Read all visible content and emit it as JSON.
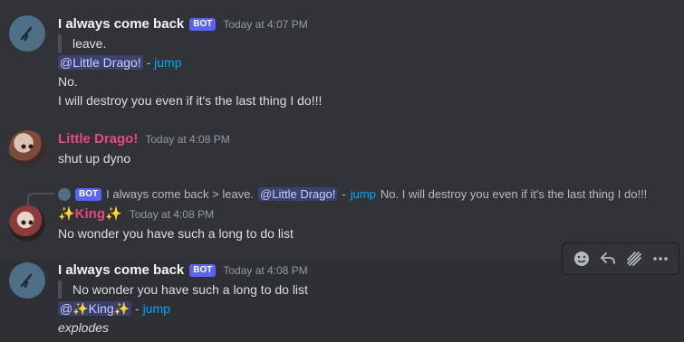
{
  "messages": [
    {
      "author": "I always come back",
      "bot_tag": "BOT",
      "time": "Today at 4:07 PM",
      "quote": "leave.",
      "mention": "@Little Drago!",
      "dash": "-",
      "jump": "jump",
      "line1": "No.",
      "line2": "I will destroy you even if it's the last thing I do!!!"
    },
    {
      "author": "Little Drago!",
      "time": "Today at 4:08 PM",
      "text": "shut up dyno"
    },
    {
      "reply": {
        "bot_tag": "BOT",
        "text_a": "I always come back > leave.",
        "mention": "@Little Drago!",
        "dash": "-",
        "jump": "jump",
        "text_b": "No. I will destroy you even if it's the last thing I do!!!"
      },
      "author": "✨King✨",
      "time": "Today at 4:08 PM",
      "text": "No wonder you have such a long to do list"
    },
    {
      "author": "I always come back",
      "bot_tag": "BOT",
      "time": "Today at 4:08 PM",
      "quote": "No wonder you have such a long to do list",
      "mention": "@✨King✨",
      "dash": "-",
      "jump": "jump",
      "text": "explodes"
    }
  ],
  "toolbar": {
    "icons": [
      "add-reaction-icon",
      "reply-icon",
      "apps-icon",
      "more-icon"
    ]
  }
}
